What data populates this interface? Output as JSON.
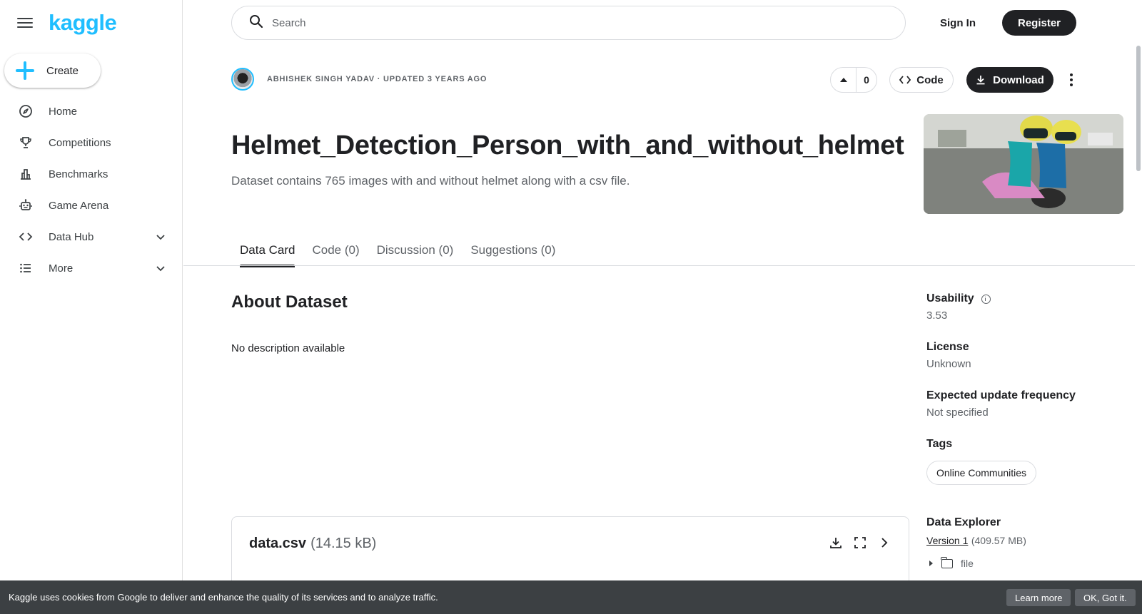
{
  "brand": {
    "logo_text": "kaggle",
    "accent_color": "#20beff"
  },
  "sidebar": {
    "create_label": "Create",
    "items": [
      {
        "label": "Home",
        "icon": "compass-icon"
      },
      {
        "label": "Competitions",
        "icon": "trophy-icon"
      },
      {
        "label": "Benchmarks",
        "icon": "bar-chart-icon"
      },
      {
        "label": "Game Arena",
        "icon": "robot-icon"
      },
      {
        "label": "Data Hub",
        "icon": "code-icon",
        "expandable": true
      },
      {
        "label": "More",
        "icon": "list-icon",
        "expandable": true
      }
    ]
  },
  "header": {
    "search_placeholder": "Search",
    "signin_label": "Sign In",
    "register_label": "Register"
  },
  "dataset": {
    "author_line": "ABHISHEK SINGH YADAV · UPDATED 3 YEARS AGO",
    "vote_count": "0",
    "code_label": "Code",
    "download_label": "Download",
    "title": "Helmet_Detection_Person_with_and_without_helmet",
    "subtitle": "Dataset contains 765 images with and without helmet along with a csv file.",
    "tabs": [
      {
        "label": "Data Card",
        "active": true
      },
      {
        "label": "Code (0)",
        "active": false
      },
      {
        "label": "Discussion (0)",
        "active": false
      },
      {
        "label": "Suggestions (0)",
        "active": false
      }
    ],
    "about_heading": "About Dataset",
    "about_text": "No description available"
  },
  "meta": {
    "usability_label": "Usability",
    "usability_value": "3.53",
    "license_label": "License",
    "license_value": "Unknown",
    "frequency_label": "Expected update frequency",
    "frequency_value": "Not specified",
    "tags_label": "Tags",
    "tags": [
      "Online Communities"
    ],
    "explorer_label": "Data Explorer",
    "version_link": "Version 1",
    "version_size": "(409.57 MB)",
    "tree_folder": "file"
  },
  "file_card": {
    "name": "data.csv",
    "size": "(14.15 kB)"
  },
  "cookie": {
    "text": "Kaggle uses cookies from Google to deliver and enhance the quality of its services and to analyze traffic.",
    "learn_more": "Learn more",
    "ok": "OK, Got it."
  }
}
